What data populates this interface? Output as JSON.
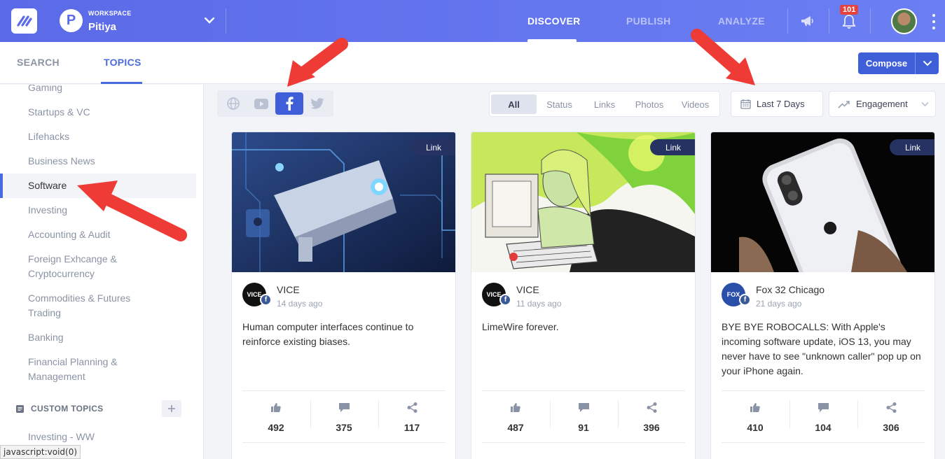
{
  "topbar": {
    "workspace_label": "WORKSPACE",
    "workspace_name": "Pitiya",
    "workspace_initial": "P",
    "nav": {
      "discover": "DISCOVER",
      "publish": "PUBLISH",
      "analyze": "ANALYZE"
    },
    "notifications_count": "101"
  },
  "subbar": {
    "tabs": {
      "search": "SEARCH",
      "topics": "TOPICS"
    },
    "compose_label": "Compose"
  },
  "sidebar": {
    "items": [
      {
        "label": "Gaming"
      },
      {
        "label": "Startups & VC"
      },
      {
        "label": "Lifehacks"
      },
      {
        "label": "Business News"
      },
      {
        "label": "Software"
      },
      {
        "label": "Investing"
      },
      {
        "label": "Accounting & Audit"
      },
      {
        "label": "Foreign Exhcange &\nCryptocurrency"
      },
      {
        "label": "Commodities & Futures\nTrading"
      },
      {
        "label": "Banking"
      },
      {
        "label": "Financial Planning &\nManagement"
      }
    ],
    "custom_topics_label": "CUSTOM TOPICS",
    "custom_items": [
      {
        "label": "Investing - WW"
      }
    ],
    "status_link": "javascript:void(0)"
  },
  "filters": {
    "types": [
      "All",
      "Status",
      "Links",
      "Photos",
      "Videos"
    ],
    "date_range": "Last 7 Days",
    "sort": "Engagement"
  },
  "cards": [
    {
      "badge": "Link",
      "source": "VICE",
      "source_logo": "VICE",
      "time": "14 days ago",
      "text": "Human computer interfaces continue to reinforce existing biases.",
      "likes": "492",
      "comments": "375",
      "shares": "117"
    },
    {
      "badge": "Link",
      "source": "VICE",
      "source_logo": "VICE",
      "time": "11 days ago",
      "text": "LimeWire forever.",
      "likes": "487",
      "comments": "91",
      "shares": "396"
    },
    {
      "badge": "Link",
      "source": "Fox 32 Chicago",
      "source_logo": "FOX",
      "time": "21 days ago",
      "text": "BYE BYE ROBOCALLS: With Apple's incoming software update, iOS 13, you may never have to see \"unknown caller\" pop up on your iPhone again.",
      "likes": "410",
      "comments": "104",
      "shares": "306"
    }
  ],
  "colors": {
    "topbar": "#5b6ae8",
    "accent": "#3e5fd8",
    "badge_red": "#e8413b",
    "annotation_arrow": "#ef3b36"
  }
}
